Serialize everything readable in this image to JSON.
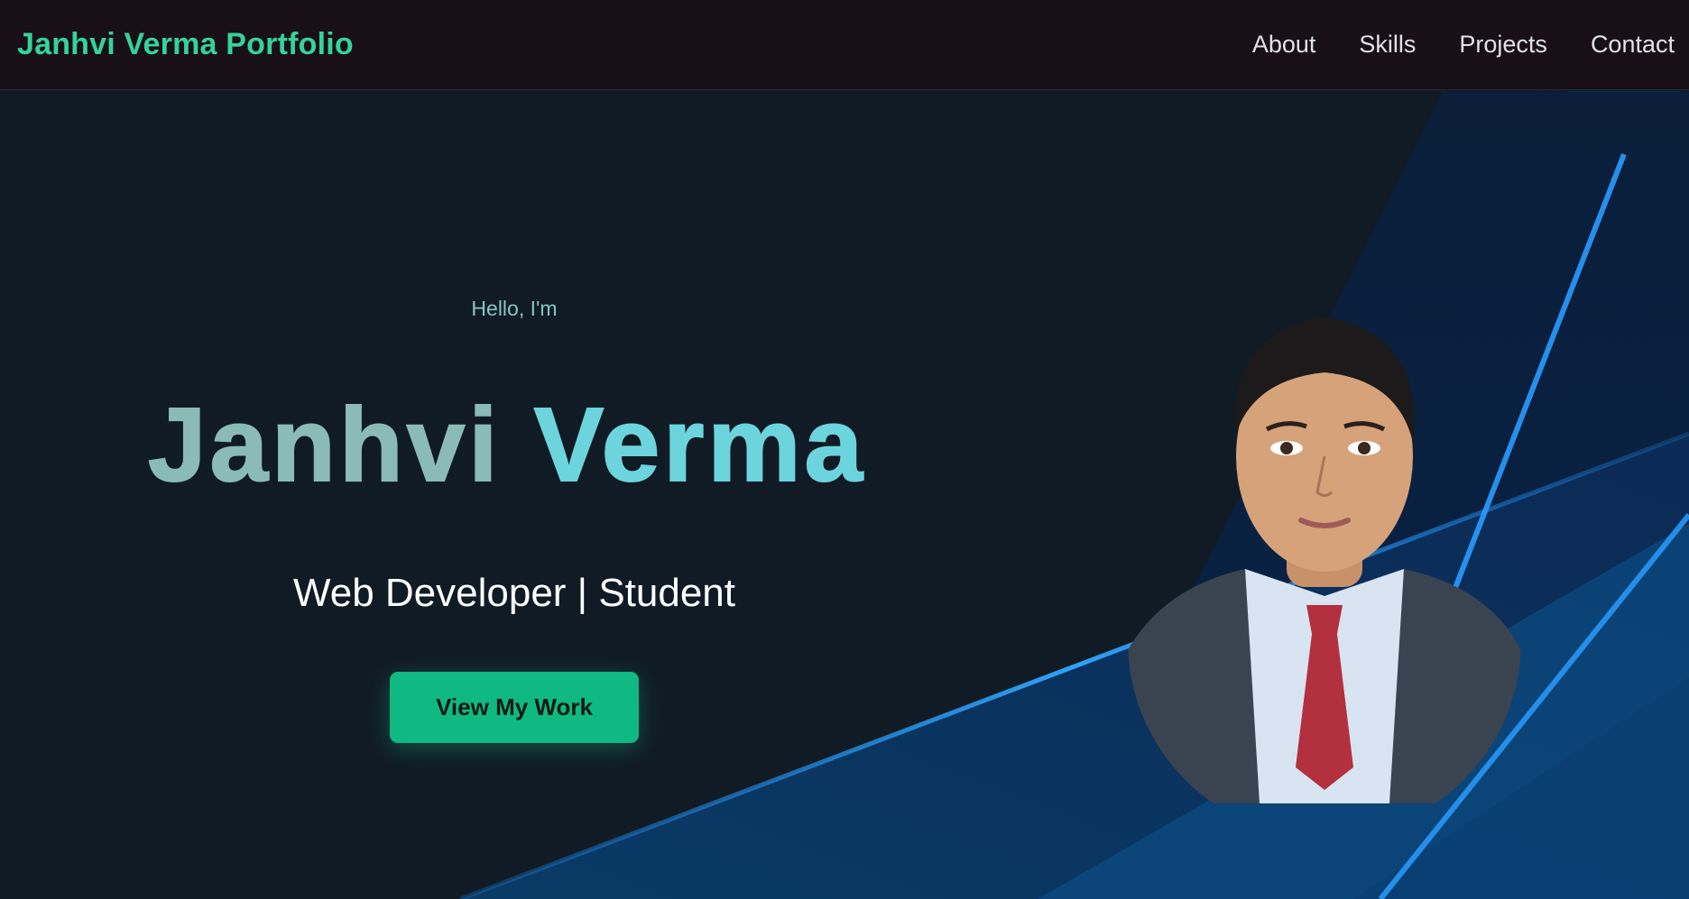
{
  "navbar": {
    "brand": "Janhvi Verma Portfolio",
    "links": [
      {
        "label": "About"
      },
      {
        "label": "Skills"
      },
      {
        "label": "Projects"
      },
      {
        "label": "Contact"
      }
    ]
  },
  "hero": {
    "greeting": "Hello, I'm",
    "first_name": "Janhvi",
    "last_name": "Verma",
    "role": "Web Developer | Student",
    "cta_label": "View My Work"
  },
  "colors": {
    "accent": "#34d399",
    "button": "#10b981",
    "nav_bg": "#190f17",
    "page_bg": "#111b25",
    "name_first": "#8bbbb6",
    "name_last": "#6cd4dc"
  },
  "icons": {
    "portrait": "profile-photo"
  }
}
